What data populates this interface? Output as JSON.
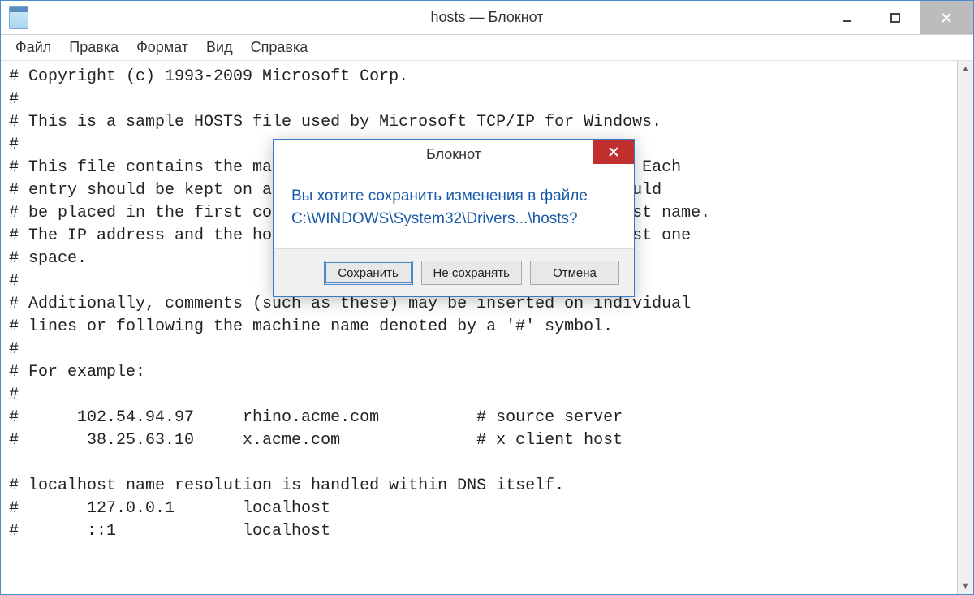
{
  "window": {
    "title": "hosts — Блокнот"
  },
  "menu": {
    "file": "Файл",
    "edit": "Правка",
    "format": "Формат",
    "view": "Вид",
    "help": "Справка"
  },
  "content": "# Copyright (c) 1993-2009 Microsoft Corp.\n#\n# This is a sample HOSTS file used by Microsoft TCP/IP for Windows.\n#\n# This file contains the mappings of IP addresses to host names. Each\n# entry should be kept on an individual line. The IP address should\n# be placed in the first column followed by the corresponding host name.\n# The IP address and the host name should be separated by at least one\n# space.\n#\n# Additionally, comments (such as these) may be inserted on individual\n# lines or following the machine name denoted by a '#' symbol.\n#\n# For example:\n#\n#      102.54.94.97     rhino.acme.com          # source server\n#       38.25.63.10     x.acme.com              # x client host\n\n# localhost name resolution is handled within DNS itself.\n#       127.0.0.1       localhost\n#       ::1             localhost",
  "dialog": {
    "title": "Блокнот",
    "message_line1": "Вы хотите сохранить изменения в файле",
    "message_line2": "C:\\WINDOWS\\System32\\Drivers...\\hosts?",
    "save": "Сохранить",
    "dontsave_prefix": "Н",
    "dontsave_rest": "е сохранять",
    "cancel": "Отмена"
  }
}
